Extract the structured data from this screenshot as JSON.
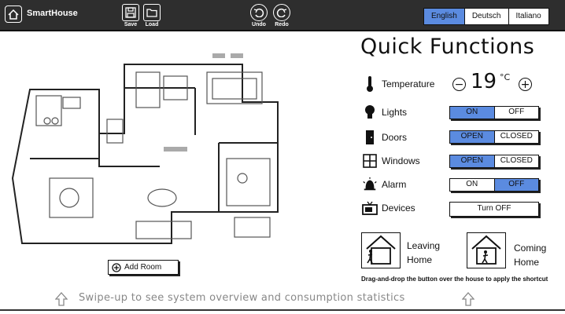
{
  "header": {
    "app_title": "SmartHouse",
    "toolbar": {
      "save_label": "Save",
      "load_label": "Load",
      "undo_label": "Undo",
      "redo_label": "Redo"
    },
    "languages": [
      {
        "label": "English",
        "active": true
      },
      {
        "label": "Deutsch",
        "active": false
      },
      {
        "label": "Italiano",
        "active": false
      }
    ]
  },
  "floorplan": {
    "add_room_label": "Add Room"
  },
  "quick_functions": {
    "title": "Quick Functions",
    "temperature": {
      "label": "Temperature",
      "value": "19",
      "unit": "°C"
    },
    "lights": {
      "label": "Lights",
      "on_label": "ON",
      "off_label": "OFF",
      "state": "ON"
    },
    "doors": {
      "label": "Doors",
      "open_label": "OPEN",
      "closed_label": "CLOSED",
      "state": "OPEN"
    },
    "windows": {
      "label": "Windows",
      "open_label": "OPEN",
      "closed_label": "CLOSED",
      "state": "OPEN"
    },
    "alarm": {
      "label": "Alarm",
      "on_label": "ON",
      "off_label": "OFF",
      "state": "OFF"
    },
    "devices": {
      "label": "Devices",
      "button_label": "Turn OFF"
    },
    "shortcuts": {
      "leaving_line1": "Leaving",
      "leaving_line2": "Home",
      "coming_line1": "Coming",
      "coming_line2": "Home",
      "hint": "Drag-and-drop the button over the house to apply the shortcut"
    }
  },
  "footer": {
    "swipe_text": "Swipe-up to see system overview and consumption statistics"
  },
  "colors": {
    "topbar": "#2e2e2e",
    "active_toggle": "#5b8be0"
  }
}
